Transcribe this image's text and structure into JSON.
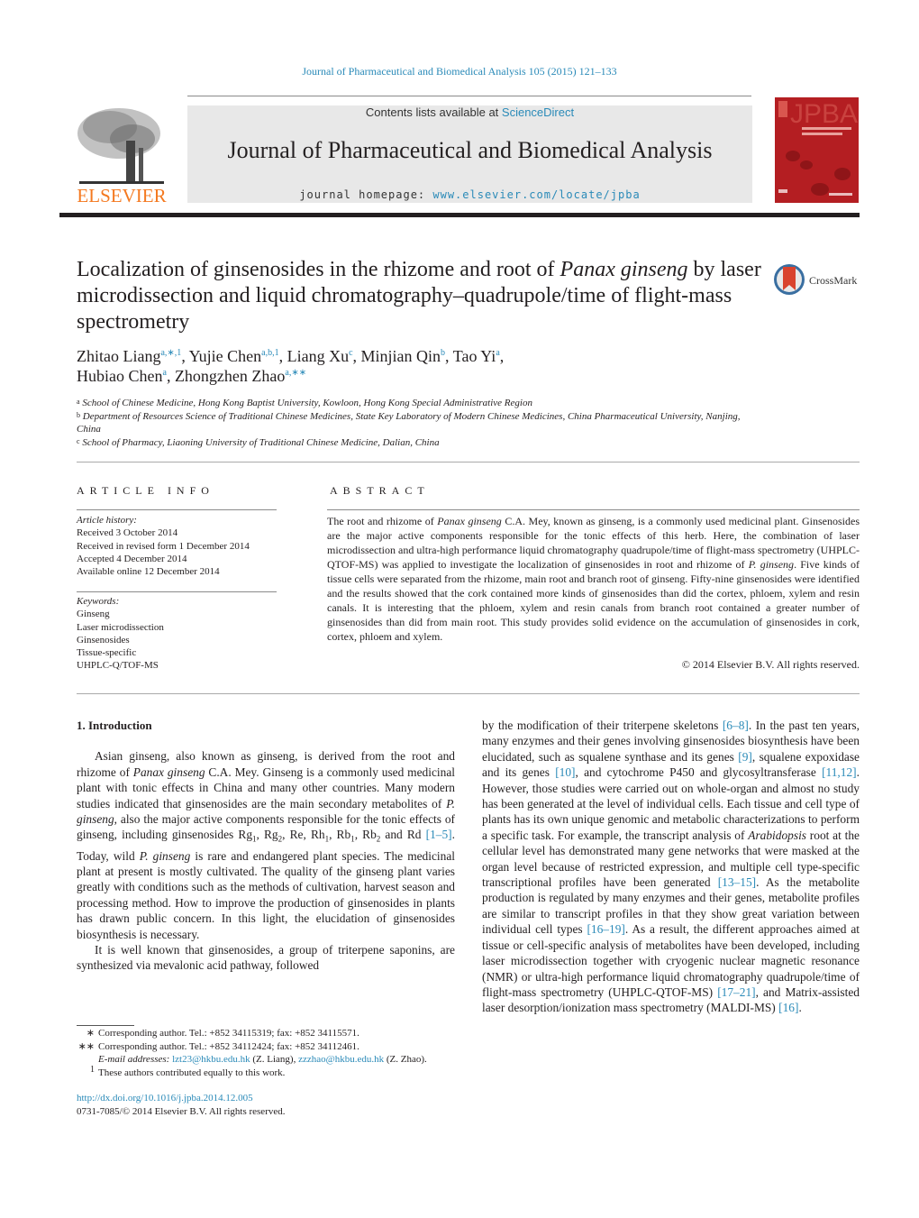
{
  "header": {
    "journal_ref": "Journal of Pharmaceutical and Biomedical Analysis 105 (2015) 121–133",
    "contents_prefix": "Contents lists available at ",
    "contents_link": "ScienceDirect",
    "journal_title": "Journal of Pharmaceutical and Biomedical Analysis",
    "homepage_prefix": "journal homepage: ",
    "homepage_link": "www.elsevier.com/locate/jpba",
    "publisher_logo_text": "ELSEVIER",
    "cover_text": "JPBA",
    "brand_color": "#f47920",
    "link_color": "#2a8ab8",
    "cover_color": "#b41e22"
  },
  "article": {
    "title_part1": "Localization of ginsenosides in the rhizome and root of ",
    "title_italic": "Panax ginseng",
    "title_part2": " by laser microdissection and liquid chromatography–quadrupole/time of flight-mass spectrometry",
    "crossmark_label": "CrossMark",
    "authors": [
      {
        "name": "Zhitao Liang",
        "sup": "a,∗,1",
        "sep": ", "
      },
      {
        "name": "Yujie Chen",
        "sup": "a,b,1",
        "sep": ", "
      },
      {
        "name": "Liang Xu",
        "sup": "c",
        "sep": ", "
      },
      {
        "name": "Minjian Qin",
        "sup": "b",
        "sep": ", "
      },
      {
        "name": "Tao Yi",
        "sup": "a",
        "sep": ","
      },
      {
        "name": "Hubiao Chen",
        "sup": "a",
        "sep": ", "
      },
      {
        "name": "Zhongzhen Zhao",
        "sup": "a,∗∗",
        "sep": ""
      }
    ],
    "affiliations": [
      {
        "key": "a",
        "text": "School of Chinese Medicine, Hong Kong Baptist University, Kowloon, Hong Kong Special Administrative Region"
      },
      {
        "key": "b",
        "text": "Department of Resources Science of Traditional Chinese Medicines, State Key Laboratory of Modern Chinese Medicines, China Pharmaceutical University, Nanjing, China"
      },
      {
        "key": "c",
        "text": "School of Pharmacy, Liaoning University of Traditional Chinese Medicine, Dalian, China"
      }
    ]
  },
  "article_info": {
    "heading": "ARTICLE INFO",
    "history_label": "Article history:",
    "history": [
      "Received 3 October 2014",
      "Received in revised form 1 December 2014",
      "Accepted 4 December 2014",
      "Available online 12 December 2014"
    ],
    "keywords_label": "Keywords:",
    "keywords": [
      "Ginseng",
      "Laser microdissection",
      "Ginsenosides",
      "Tissue-specific",
      "UHPLC-Q/TOF-MS"
    ]
  },
  "abstract": {
    "heading": "ABSTRACT",
    "text_1": "The root and rhizome of ",
    "italic_1": "Panax ginseng",
    "text_2": " C.A. Mey, known as ginseng, is a commonly used medicinal plant. Ginsenosides are the major active components responsible for the tonic effects of this herb. Here, the combination of laser microdissection and ultra-high performance liquid chromatography quadrupole/time of flight-mass spectrometry (UHPLC-QTOF-MS) was applied to investigate the localization of ginsenosides in root and rhizome of ",
    "italic_2": "P. ginseng",
    "text_3": ". Five kinds of tissue cells were separated from the rhizome, main root and branch root of ginseng. Fifty-nine ginsenosides were identified and the results showed that the cork contained more kinds of ginsenosides than did the cortex, phloem, xylem and resin canals. It is interesting that the phloem, xylem and resin canals from branch root contained a greater number of ginsenosides than did from main root. This study provides solid evidence on the accumulation of ginsenosides in cork, cortex, phloem and xylem.",
    "copyright": "© 2014 Elsevier B.V. All rights reserved."
  },
  "body": {
    "section_heading": "1.  Introduction",
    "p1_a": "Asian ginseng, also known as ginseng, is derived from the root and rhizome of ",
    "p1_i1": "Panax ginseng",
    "p1_b": " C.A. Mey. Ginseng is a commonly used medicinal plant with tonic effects in China and many other countries. Many modern studies indicated that ginsenosides are the main secondary metabolites of ",
    "p1_i2": "P. ginseng",
    "p1_c": ", also the major active components responsible for the tonic effects of ginseng, including ginsenosides Rg",
    "sub1": "1",
    "p1_d": ", Rg",
    "sub2": "2",
    "p1_e": ", Re, Rh",
    "sub3": "1",
    "p1_f": ", Rb",
    "sub4": "1",
    "p1_g": ", Rb",
    "sub5": "2",
    "p1_h": " and Rd ",
    "cite_1_5": "[1–5]",
    "p1_i": ". Today, wild ",
    "p1_i3": "P. ginseng",
    "p1_j": " is rare and endangered plant species. The medicinal plant at present is mostly cultivated. The quality of the ginseng plant varies greatly with conditions such as the methods of cultivation, harvest season and processing method. How to improve the production of ginsenosides in plants has drawn public concern. In this light, the elucidation of ginsenosides biosynthesis is necessary.",
    "p2_a": "It is well known that ginsenosides, a group of triterpene saponins, are synthesized via mevalonic acid pathway, followed by the modification of their triterpene skeletons ",
    "cite_6_8": "[6–8]",
    "p2_b": ". In the past ten years, many enzymes and their genes involving ginsenosides biosynthesis have been elucidated, such as squalene synthase and its genes ",
    "cite_9": "[9]",
    "p2_c": ", squalene expoxidase and its genes ",
    "cite_10": "[10]",
    "p2_d": ", and cytochrome P450 and glycosyltransferase ",
    "cite_11_12": "[11,12]",
    "p2_e": ". However, those studies were carried out on whole-organ and almost no study has been generated at the level of individual cells. Each tissue and cell type of plants has its own unique genomic and metabolic characterizations to perform a specific task. For example, the transcript analysis of ",
    "p2_i1": "Arabidopsis",
    "p2_f": " root at the cellular level has demonstrated many gene networks that were masked at the organ level because of restricted expression, and multiple cell type-specific transcriptional profiles have been generated ",
    "cite_13_15": "[13–15]",
    "p2_g": ". As the metabolite production is regulated by many enzymes and their genes, metabolite profiles are similar to transcript profiles in that they show great variation between individual cell types ",
    "cite_16_19": "[16–19]",
    "p2_h": ". As a result, the different approaches aimed at tissue or cell-specific analysis of metabolites have been developed, including laser microdissection together with cryogenic nuclear magnetic resonance (NMR) or ultra-high performance liquid chromatography quadrupole/time of flight-mass spectrometry (UHPLC-QTOF-MS) ",
    "cite_17_21": "[17–21]",
    "p2_j": ", and Matrix-assisted laser desorption/ionization mass spectrometry (MALDI-MS) ",
    "cite_16": "[16]",
    "p2_k": "."
  },
  "footnotes": {
    "fn1_mark": "∗",
    "fn1_text": "Corresponding author. Tel.: +852 34115319; fax: +852 34115571.",
    "fn2_mark": "∗∗",
    "fn2_text": "Corresponding author. Tel.: +852 34112424; fax: +852 34112461.",
    "email_label": "E-mail addresses:",
    "email_1": "lzt23@hkbu.edu.hk",
    "email_1_name": " (Z. Liang), ",
    "email_2": "zzzhao@hkbu.edu.hk",
    "email_2_name": " (Z. Zhao).",
    "fn3_mark": "1",
    "fn3_text": "These authors contributed equally to this work.",
    "doi": "http://dx.doi.org/10.1016/j.jpba.2014.12.005",
    "issn_line": "0731-7085/© 2014 Elsevier B.V. All rights reserved."
  }
}
